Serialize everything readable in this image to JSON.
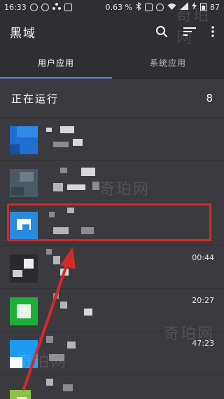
{
  "status_bar": {
    "time": "16:33",
    "speed": "0.63 %",
    "battery": "87"
  },
  "app_bar": {
    "title": "黑域"
  },
  "tabs": [
    {
      "label": "用户应用",
      "active": true
    },
    {
      "label": "系统应用",
      "active": false
    }
  ],
  "section": {
    "title": "正在运行",
    "count": "8"
  },
  "rows": [
    {
      "time": ""
    },
    {
      "time": ""
    },
    {
      "time": ""
    },
    {
      "time": "00:44"
    },
    {
      "time": "20:27"
    },
    {
      "time": "47:23"
    },
    {
      "time": ""
    }
  ],
  "watermarks": [
    "奇珀网",
    "奇珀网",
    "奇珀网",
    "奇珀网"
  ],
  "colors": {
    "accent": "#5b8def",
    "highlight": "#d22a2a",
    "background": "#3b3a3f",
    "bar": "#2f2e33"
  }
}
